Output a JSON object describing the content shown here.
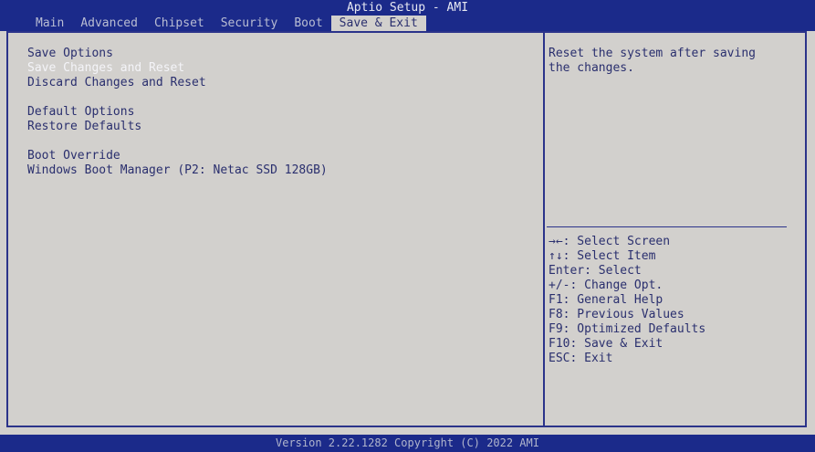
{
  "header": {
    "title": "Aptio Setup - AMI",
    "tabs": [
      "Main",
      "Advanced",
      "Chipset",
      "Security",
      "Boot",
      "Save & Exit"
    ],
    "active_tab": "Save & Exit"
  },
  "main": {
    "save_options": {
      "heading": "Save Options",
      "items": [
        "Save Changes and Reset",
        "Discard Changes and Reset"
      ]
    },
    "default_options": {
      "heading": "Default Options",
      "items": [
        "Restore Defaults"
      ]
    },
    "boot_override": {
      "heading": "Boot Override",
      "items": [
        "Windows Boot Manager (P2: Netac SSD 128GB)"
      ]
    },
    "selected_item": "Save Changes and Reset"
  },
  "help": {
    "description": [
      "Reset the system after saving",
      "the changes."
    ],
    "keys": [
      "→←: Select Screen",
      "↑↓: Select Item",
      "Enter: Select",
      "+/-: Change Opt.",
      "F1: General Help",
      "F8: Previous Values",
      "F9: Optimized Defaults",
      "F10: Save & Exit",
      "ESC: Exit"
    ]
  },
  "footer": {
    "text": "Version 2.22.1282 Copyright (C) 2022 AMI"
  },
  "colors": {
    "header_bg": "#1b2a8a",
    "panel_bg": "#d2d0cd",
    "text": "#2a2f6e",
    "selected_text": "#f4f4f8",
    "border": "#2b338a"
  }
}
